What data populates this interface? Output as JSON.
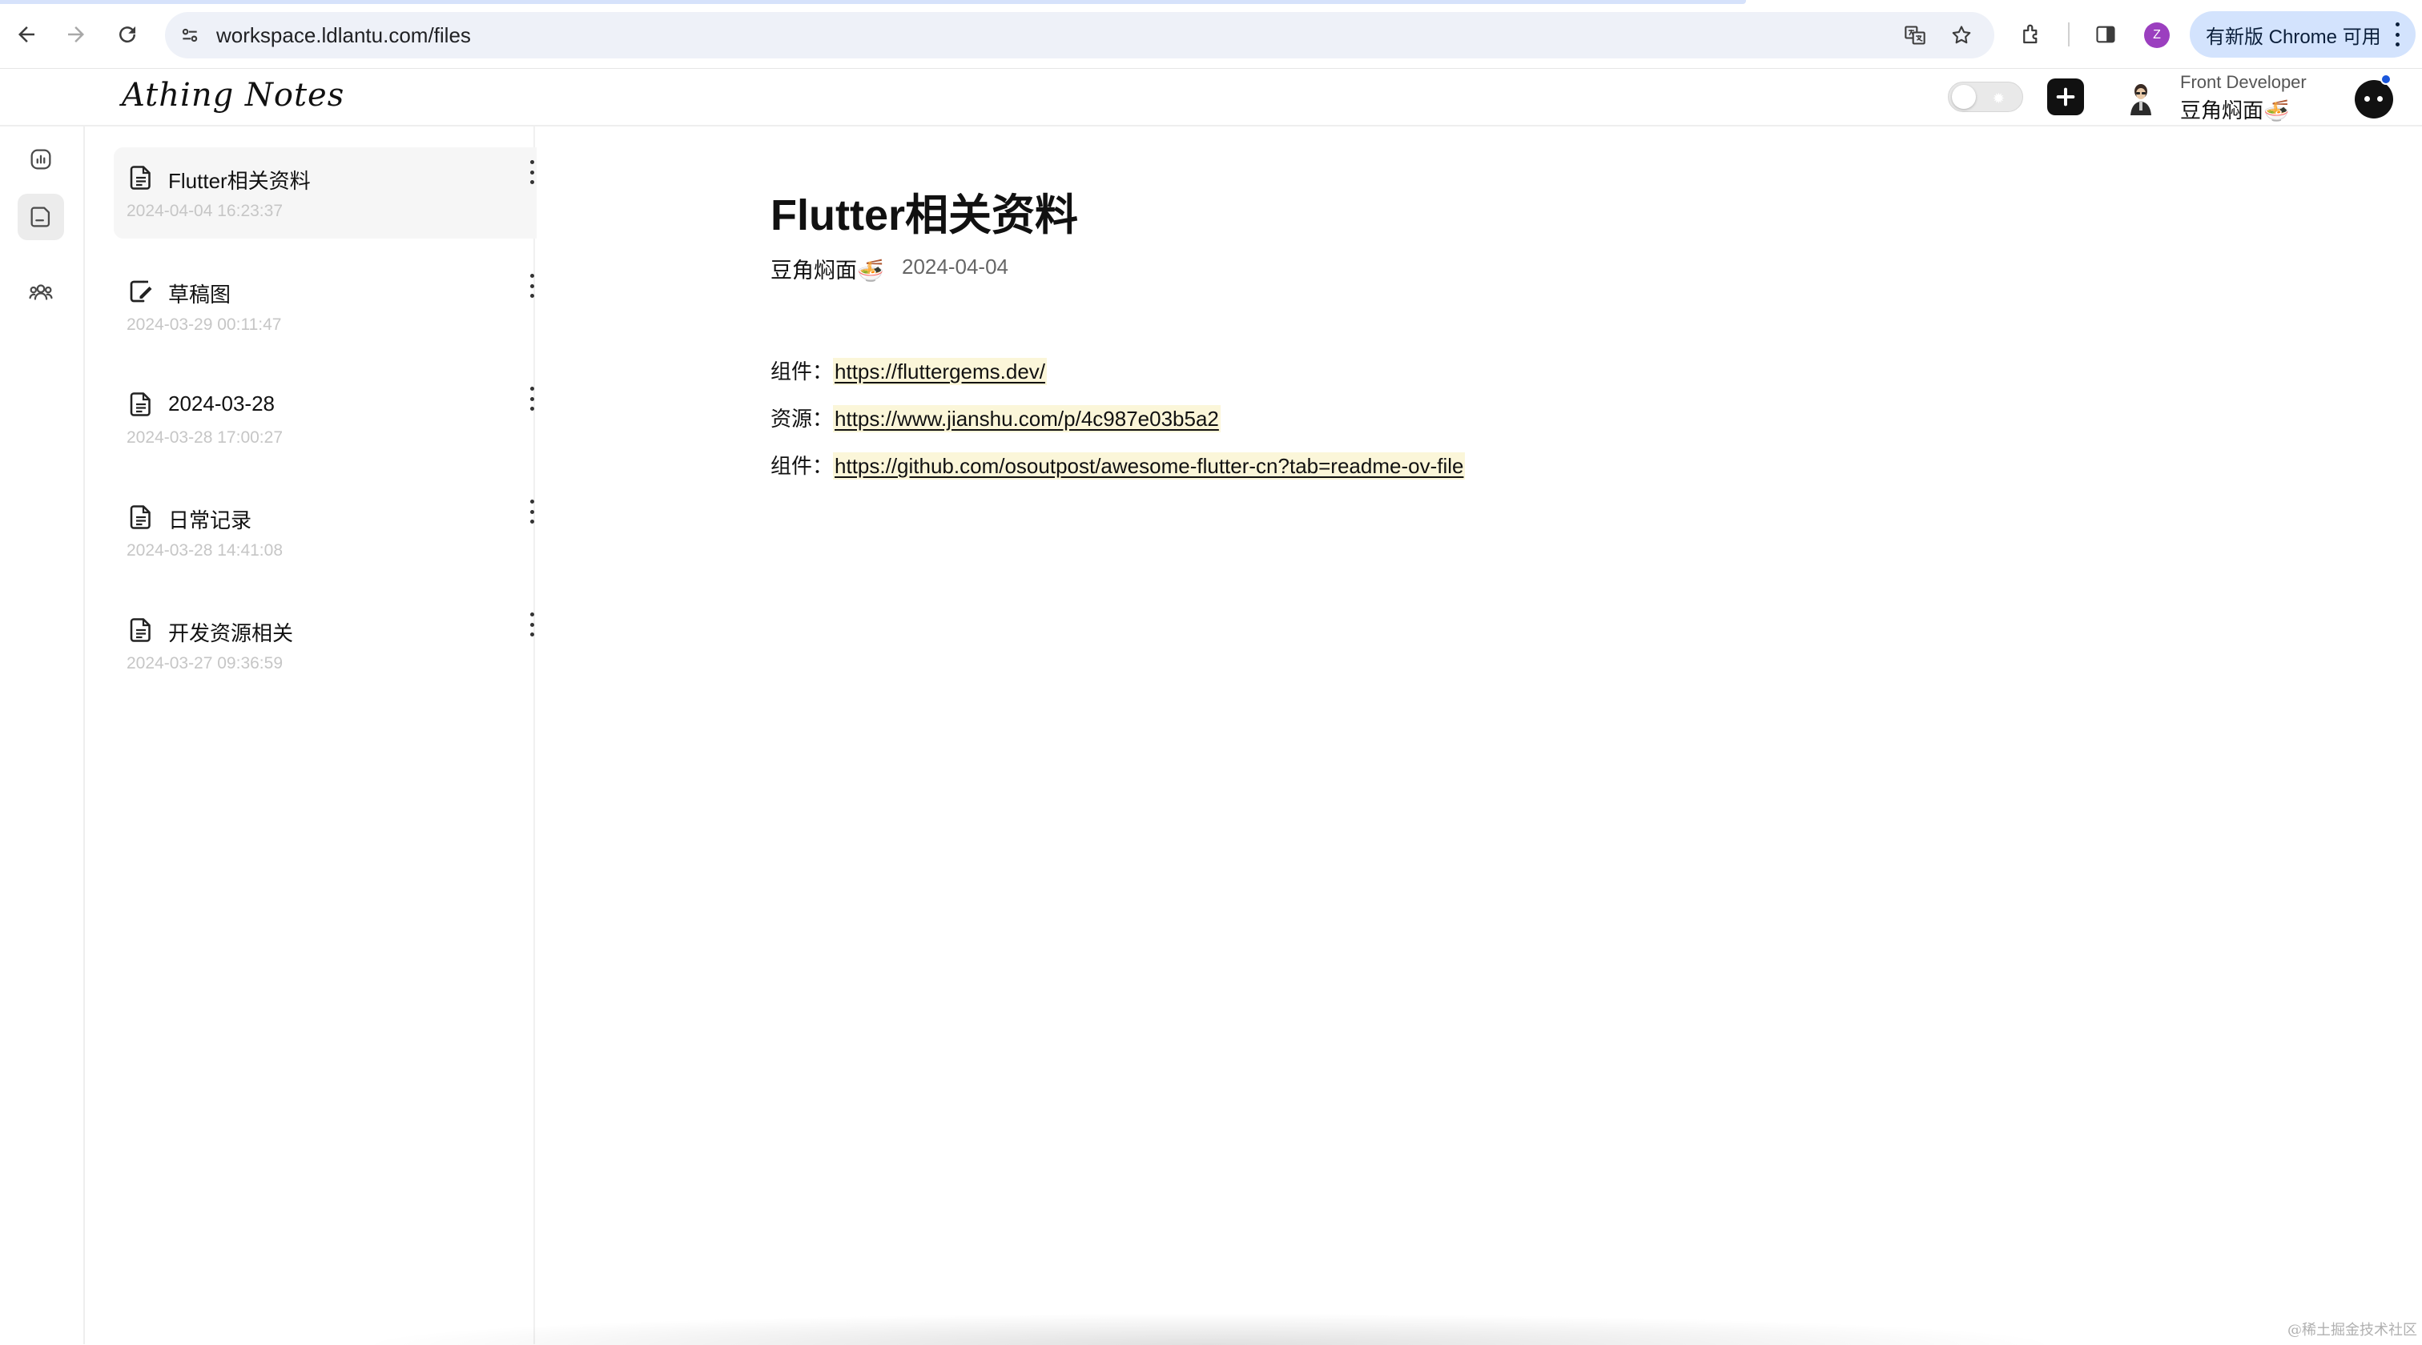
{
  "browser": {
    "url": "workspace.ldlantu.com/files",
    "profile_initial": "Z",
    "update_label": "有新版 Chrome 可用"
  },
  "app": {
    "brand": "Athing Notes",
    "user_role": "Front Developer",
    "user_name": "豆角焖面🍜"
  },
  "files": [
    {
      "title": "Flutter相关资料",
      "date": "2024-04-04 16:23:37",
      "icon": "document-icon",
      "selected": true
    },
    {
      "title": "草稿图",
      "date": "2024-03-29 00:11:47",
      "icon": "sketch-icon",
      "selected": false
    },
    {
      "title": "2024-03-28",
      "date": "2024-03-28 17:00:27",
      "icon": "document-icon",
      "selected": false
    },
    {
      "title": "日常记录",
      "date": "2024-03-28 14:41:08",
      "icon": "document-icon",
      "selected": false
    },
    {
      "title": "开发资源相关",
      "date": "2024-03-27 09:36:59",
      "icon": "document-icon",
      "selected": false
    }
  ],
  "document": {
    "title": "Flutter相关资料",
    "author": "豆角焖面🍜",
    "date": "2024-04-04",
    "lines": [
      {
        "label": "组件：",
        "link": "https://fluttergems.dev/"
      },
      {
        "label": "资源：",
        "link": "https://www.jianshu.com/p/4c987e03b5a2"
      },
      {
        "label": "组件：",
        "link": "https://github.com/osoutpost/awesome-flutter-cn?tab=readme-ov-file"
      }
    ]
  },
  "watermark": "@稀土掘金技术社区",
  "colors": {
    "link_highlight": "#fbf6d9",
    "update_pill": "#d3e3fd",
    "profile_avatar": "#9b3fbf",
    "notify_dot": "#1a56db"
  }
}
